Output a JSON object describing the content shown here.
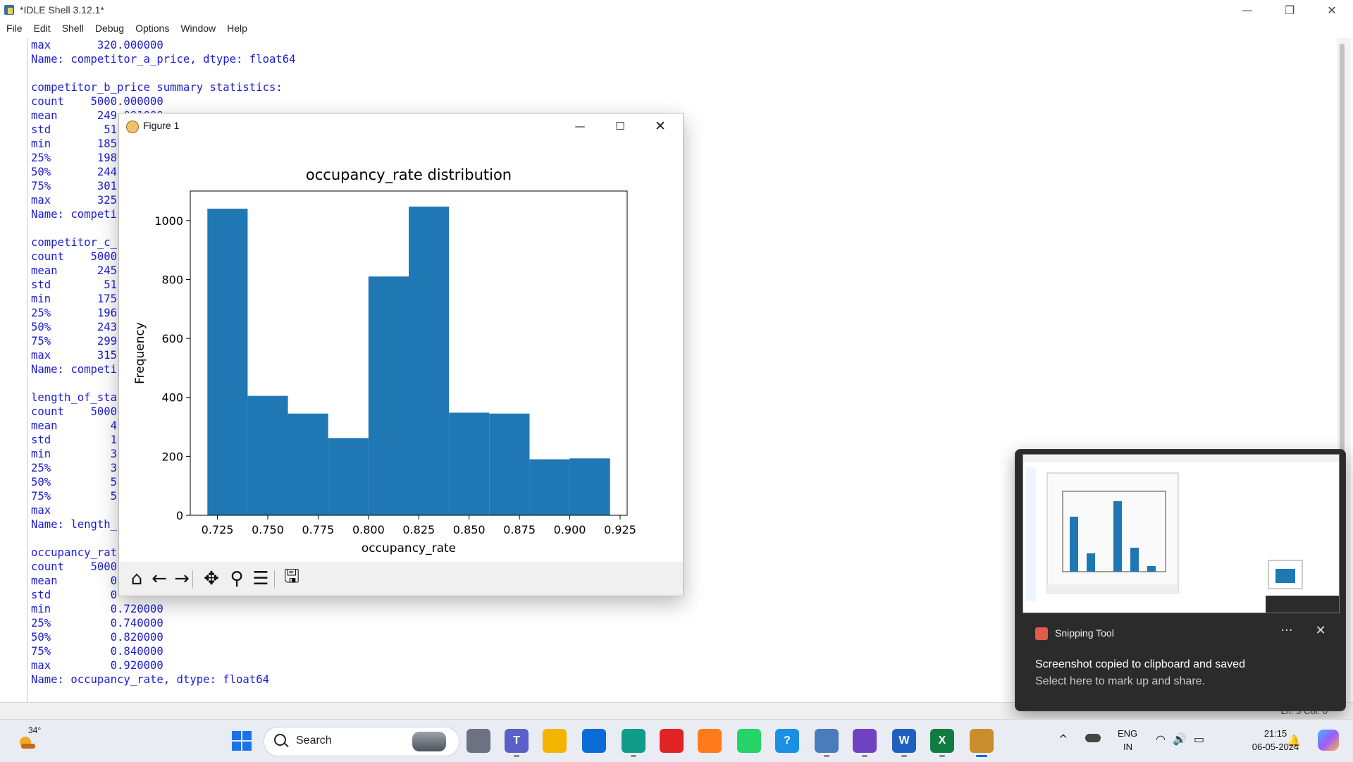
{
  "idle": {
    "title": "*IDLE Shell 3.12.1*",
    "menu": [
      "File",
      "Edit",
      "Shell",
      "Debug",
      "Options",
      "Window",
      "Help"
    ],
    "lines": [
      "max       320.000000",
      "Name: competitor_a_price, dtype: float64",
      "",
      "competitor_b_price summary statistics:",
      "count    5000.000000",
      "mean      249.091000",
      "std        51",
      "min       185",
      "25%       198",
      "50%       244",
      "75%       301",
      "max       325",
      "Name: competi",
      "",
      "competitor_c_",
      "count    5000",
      "mean      245",
      "std        51",
      "min       175",
      "25%       196",
      "50%       243",
      "75%       299",
      "max       315",
      "Name: competi",
      "",
      "length_of_sta",
      "count    5000",
      "mean        4",
      "std         1",
      "min         3",
      "25%         3",
      "50%         5",
      "75%         5",
      "max",
      "Name: length_",
      "",
      "occupancy_rat",
      "count    5000",
      "mean        0",
      "std         0",
      "min         0.720000",
      "25%         0.740000",
      "50%         0.820000",
      "75%         0.840000",
      "max         0.920000",
      "Name: occupancy_rate, dtype: float64"
    ],
    "status": "Ln: 5   Col: 0",
    "window_controls": {
      "minimize": "—",
      "maximize": "❐",
      "close": "✕"
    }
  },
  "figure": {
    "title": "Figure 1",
    "controls": {
      "minimize": "—",
      "maximize": "☐",
      "close": "✕"
    },
    "toolbar": [
      {
        "name": "home-icon",
        "glyph": "⌂"
      },
      {
        "name": "back-icon",
        "glyph": "←"
      },
      {
        "name": "forward-icon",
        "glyph": "→"
      },
      {
        "name": "pan-icon",
        "glyph": "✥"
      },
      {
        "name": "zoom-icon",
        "glyph": "⚲"
      },
      {
        "name": "configure-subplots-icon",
        "glyph": "☰"
      },
      {
        "name": "save-icon",
        "glyph": "🖫"
      }
    ]
  },
  "chart_data": {
    "type": "bar",
    "title": "occupancy_rate distribution",
    "xlabel": "occupancy_rate",
    "ylabel": "Frequency",
    "bin_edges": [
      0.72,
      0.74,
      0.76,
      0.78,
      0.8,
      0.82,
      0.84,
      0.86,
      0.88,
      0.9,
      0.92
    ],
    "values": [
      1040,
      405,
      345,
      262,
      810,
      1047,
      348,
      345,
      190,
      193
    ],
    "xlim": [
      0.7115,
      0.9285
    ],
    "ylim": [
      0,
      1100
    ],
    "xticks": [
      0.725,
      0.75,
      0.775,
      0.8,
      0.825,
      0.85,
      0.875,
      0.9,
      0.925
    ],
    "xtick_labels": [
      "0.725",
      "0.750",
      "0.775",
      "0.800",
      "0.825",
      "0.850",
      "0.875",
      "0.900",
      "0.925"
    ],
    "yticks": [
      0,
      200,
      400,
      600,
      800,
      1000
    ],
    "ytick_labels": [
      "0",
      "200",
      "400",
      "600",
      "800",
      "1000"
    ],
    "grid": false,
    "color": "#1f77b4"
  },
  "notification": {
    "app": "Snipping Tool",
    "message": "Screenshot copied to clipboard and saved",
    "sub": "Select here to mark up and share.",
    "more": "···",
    "close": "✕"
  },
  "taskbar": {
    "temperature": "34°",
    "search": "Search",
    "apps": [
      {
        "name": "task-view-icon",
        "label": "",
        "color": "#6b7280"
      },
      {
        "name": "teams-icon",
        "label": "T",
        "color": "#5b5fc7"
      },
      {
        "name": "file-explorer-icon",
        "label": "",
        "color": "#f4b400"
      },
      {
        "name": "microsoft-store-icon",
        "label": "",
        "color": "#0a6cd6"
      },
      {
        "name": "edge-icon",
        "label": "",
        "color": "#0f9d8a"
      },
      {
        "name": "app-red-diamond-icon",
        "label": "",
        "color": "#e02424"
      },
      {
        "name": "firefox-icon",
        "label": "",
        "color": "#ff7a1a"
      },
      {
        "name": "whatsapp-icon",
        "label": "",
        "color": "#25d366"
      },
      {
        "name": "help-icon",
        "label": "?",
        "color": "#1a8fe3"
      },
      {
        "name": "python-file-icon",
        "label": "",
        "color": "#4a7bbd"
      },
      {
        "name": "github-icon",
        "label": "",
        "color": "#6f42c1"
      },
      {
        "name": "word-icon",
        "label": "W",
        "color": "#1f5fbf"
      },
      {
        "name": "excel-icon",
        "label": "X",
        "color": "#107c41"
      },
      {
        "name": "matplotlib-figure-icon",
        "label": "",
        "color": "#c98e2b"
      }
    ],
    "tray": {
      "chevron": "^",
      "lang1": "ENG",
      "lang2": "IN",
      "wifi": "◠",
      "volume": "🔊",
      "battery": "▭"
    },
    "time": "21:15",
    "date": "06-05-2024",
    "bell": "🔔"
  }
}
